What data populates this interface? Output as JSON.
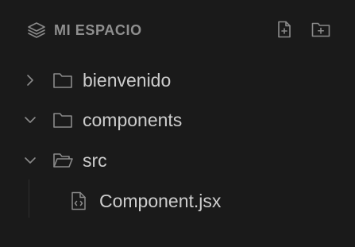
{
  "explorer": {
    "title": "MI ESPACIO",
    "actions": {
      "new_file_icon": "file-plus-icon",
      "new_folder_icon": "folder-plus-icon"
    }
  },
  "tree": {
    "items": [
      {
        "label": "bienvenido",
        "type": "folder",
        "state": "collapsed",
        "depth": 0
      },
      {
        "label": "components",
        "type": "folder",
        "state": "expanded",
        "depth": 0
      },
      {
        "label": "src",
        "type": "folder",
        "state": "expanded-open",
        "depth": 0
      },
      {
        "label": "Component.jsx",
        "type": "file",
        "depth": 1
      }
    ]
  },
  "colors": {
    "background": "#1a1a1a",
    "text": "#cdcdcd",
    "header_text": "#8f8f8f",
    "icon": "#8a8a8a"
  }
}
